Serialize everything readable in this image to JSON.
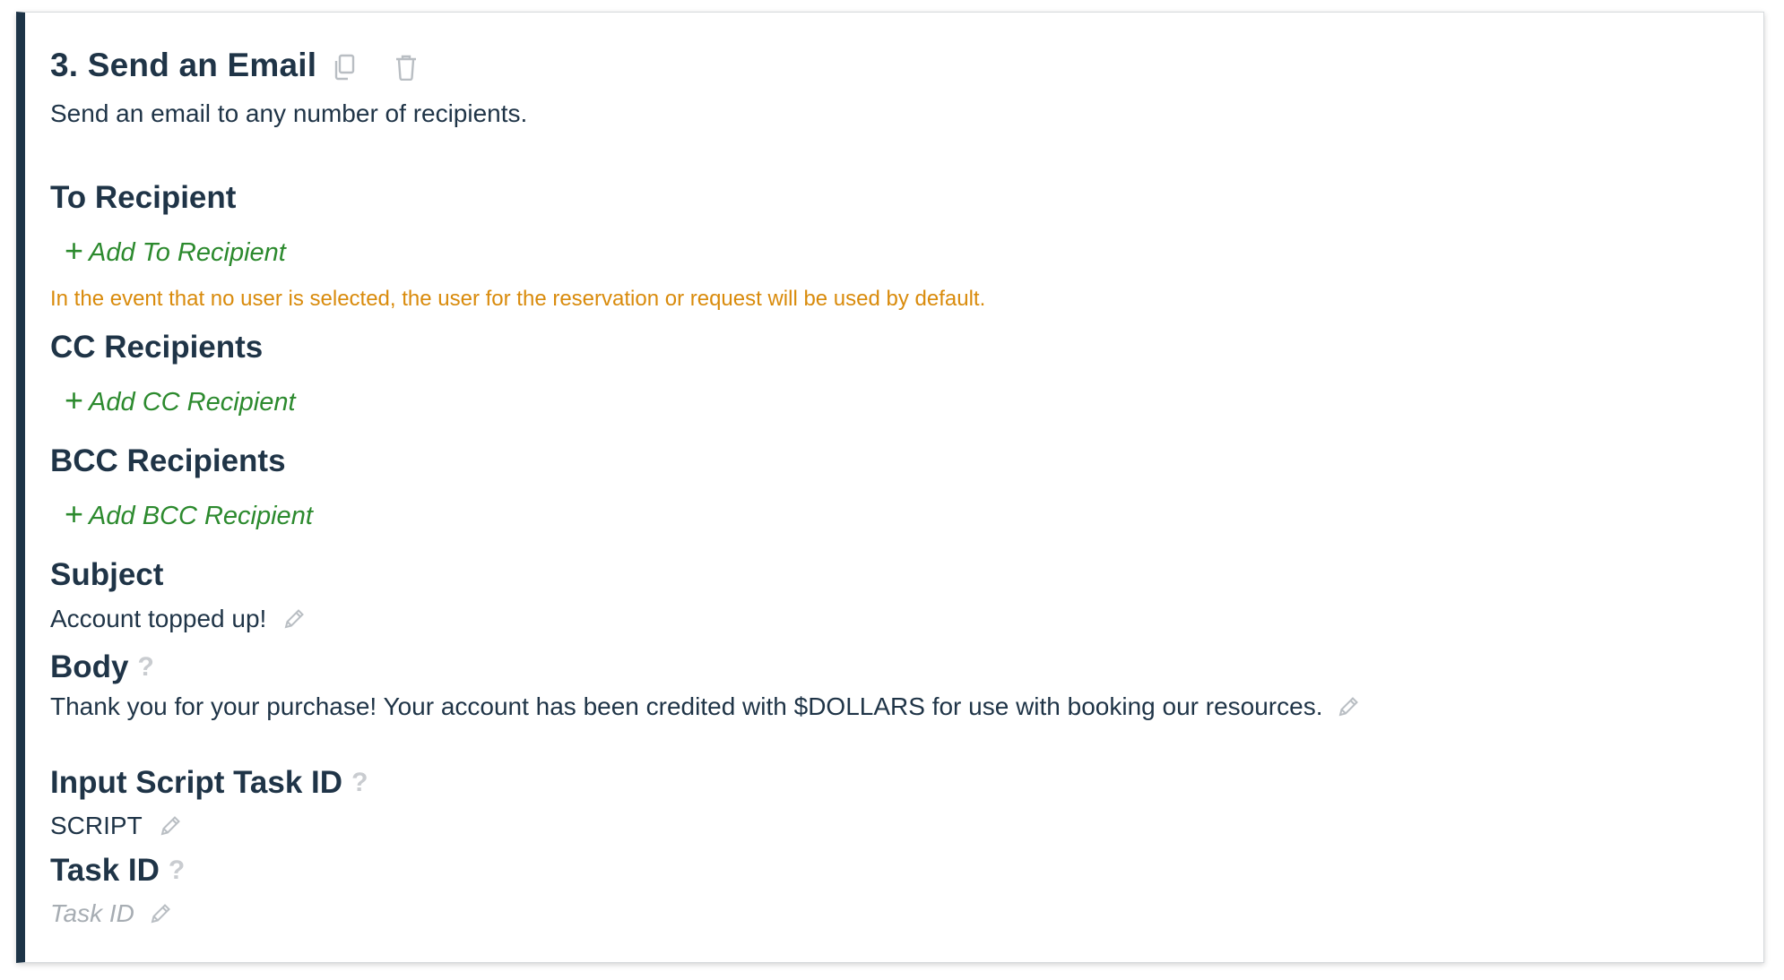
{
  "step": {
    "title": "3. Send an Email",
    "description": "Send an email to any number of recipients."
  },
  "to_recipient": {
    "heading": "To Recipient",
    "add_label": "Add To Recipient",
    "note": "In the event that no user is selected, the user for the reservation or request will be used by default."
  },
  "cc_recipients": {
    "heading": "CC Recipients",
    "add_label": "Add CC Recipient"
  },
  "bcc_recipients": {
    "heading": "BCC Recipients",
    "add_label": "Add BCC Recipient"
  },
  "subject": {
    "heading": "Subject",
    "value": "Account topped up!"
  },
  "body": {
    "heading": "Body",
    "help": "?",
    "value": "Thank you for your purchase! Your account has been credited with $DOLLARS for use with booking our resources."
  },
  "input_script_task_id": {
    "heading": "Input Script Task ID",
    "help": "?",
    "value": "SCRIPT"
  },
  "task_id": {
    "heading": "Task ID",
    "help": "?",
    "placeholder": "Task ID"
  },
  "icons": {
    "copy": "copy-icon",
    "delete": "trash-icon",
    "edit": "pencil-icon",
    "add": "plus-icon",
    "help": "help-icon"
  },
  "colors": {
    "accent_bar": "#1d3447",
    "heading_text": "#1f3447",
    "add_link": "#2c8a2e",
    "warning": "#d98b0c",
    "muted_icon": "#b9bec3",
    "placeholder": "#a7adb3"
  }
}
